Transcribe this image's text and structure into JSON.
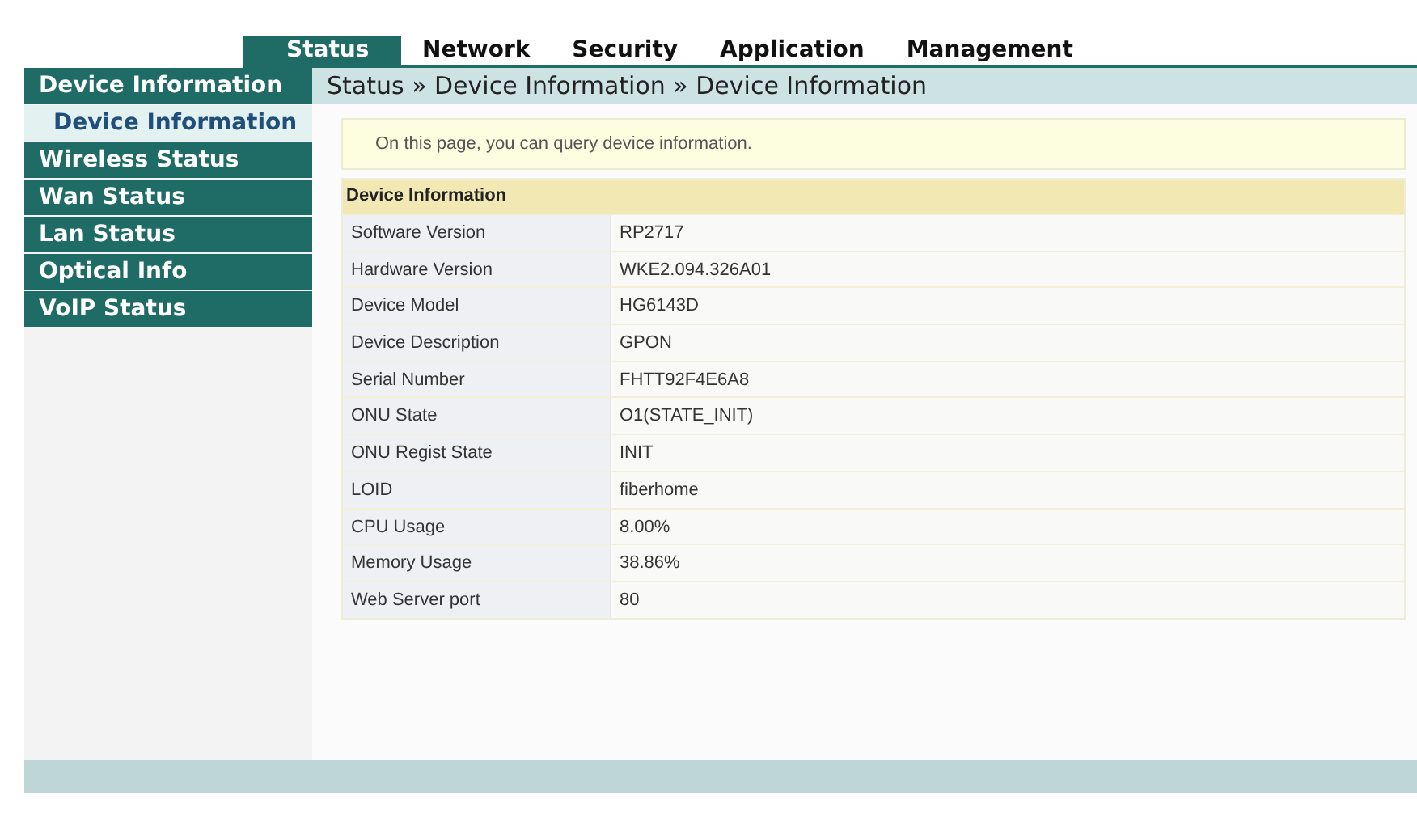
{
  "top_tabs": [
    {
      "label": "Status",
      "selected": true
    },
    {
      "label": "Network",
      "selected": false
    },
    {
      "label": "Security",
      "selected": false
    },
    {
      "label": "Application",
      "selected": false
    },
    {
      "label": "Management",
      "selected": false
    }
  ],
  "sidebar": {
    "title": "Device Information",
    "items": [
      {
        "label": "Device Information",
        "kind": "sub",
        "selected": true
      },
      {
        "label": "Wireless Status",
        "kind": "section",
        "selected": false
      },
      {
        "label": "Wan Status",
        "kind": "section",
        "selected": false
      },
      {
        "label": "Lan Status",
        "kind": "section",
        "selected": false
      },
      {
        "label": "Optical Info",
        "kind": "section",
        "selected": false
      },
      {
        "label": "VoIP Status",
        "kind": "section",
        "selected": false
      }
    ]
  },
  "breadcrumb": "Status » Device Information » Device Information",
  "notice": "On this page, you can query device information.",
  "table": {
    "title": "Device Information",
    "rows": [
      {
        "label": "Software Version",
        "value": "RP2717"
      },
      {
        "label": "Hardware Version",
        "value": "WKE2.094.326A01"
      },
      {
        "label": "Device Model",
        "value": "HG6143D"
      },
      {
        "label": "Device Description",
        "value": "GPON"
      },
      {
        "label": "Serial Number",
        "value": "FHTT92F4E6A8"
      },
      {
        "label": "ONU State",
        "value": "O1(STATE_INIT)"
      },
      {
        "label": "ONU Regist State",
        "value": "INIT"
      },
      {
        "label": "LOID",
        "value": "fiberhome"
      },
      {
        "label": "CPU Usage",
        "value": "8.00%"
      },
      {
        "label": "Memory Usage",
        "value": "38.86%"
      },
      {
        "label": "Web Server port",
        "value": "80"
      }
    ]
  }
}
